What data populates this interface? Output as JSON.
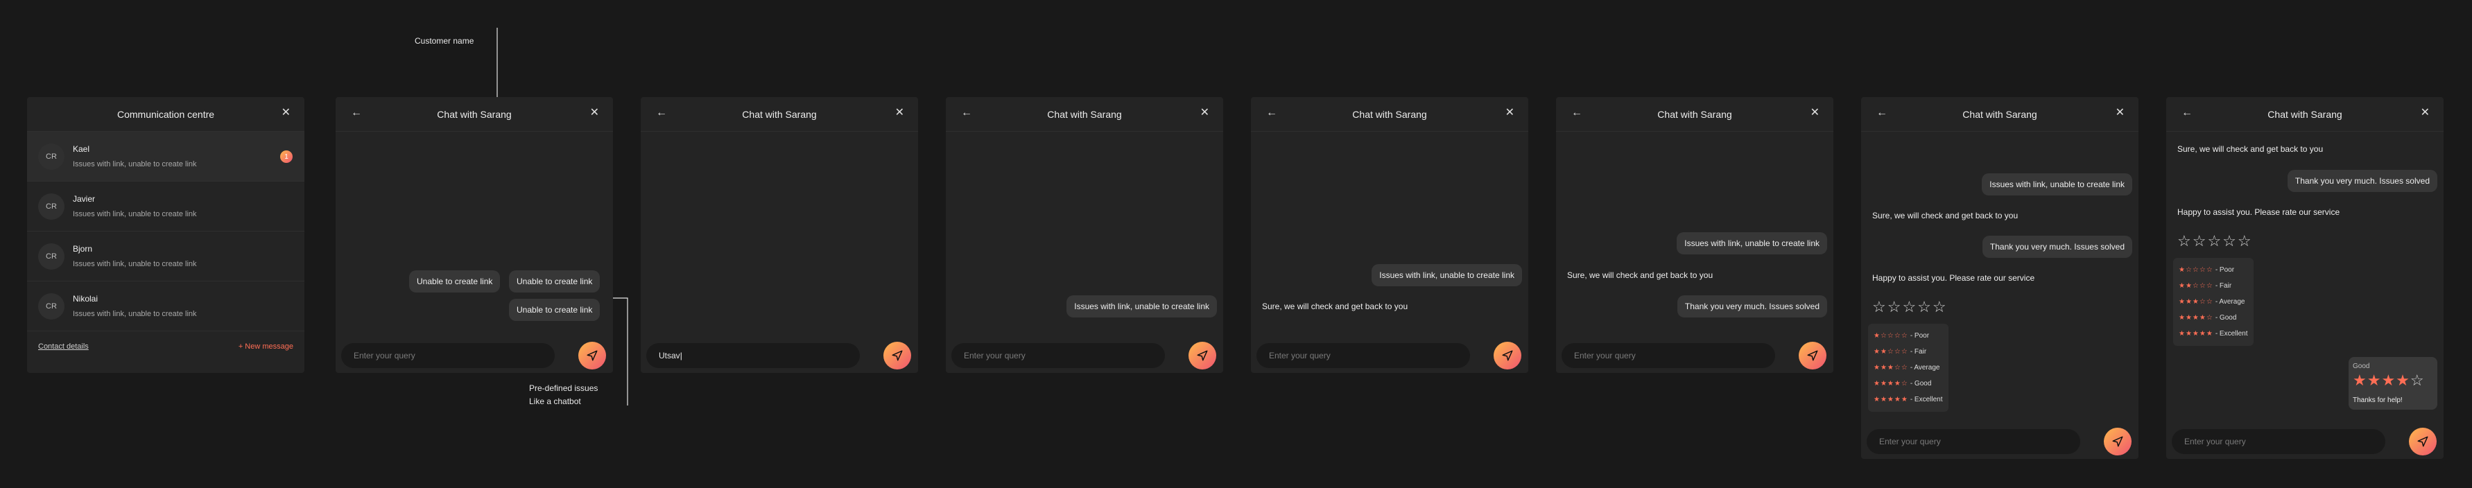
{
  "annotations": {
    "customer_name": "Customer name",
    "predefined_line1": "Pre-defined issues",
    "predefined_line2": "Like a chatbot"
  },
  "comm_centre": {
    "title": "Communication centre",
    "close": "✕",
    "contacts": [
      {
        "initials": "CR",
        "name": "Kael",
        "message": "Issues with link, unable to create link",
        "badge": "1"
      },
      {
        "initials": "CR",
        "name": "Javier",
        "message": "Issues with link, unable to create link"
      },
      {
        "initials": "CR",
        "name": "Bjorn",
        "message": "Issues with link, unable to create link"
      },
      {
        "initials": "CR",
        "name": "Nikolai",
        "message": "Issues with link, unable to create link"
      }
    ],
    "footer": {
      "contact_details": "Contact details",
      "new_message": "+ New message"
    }
  },
  "chat": {
    "title": "Chat with Sarang",
    "back": "←",
    "close": "✕",
    "placeholder": "Enter your query",
    "typed": "Utsav"
  },
  "messages": {
    "unable": "Unable to create link",
    "issues": "Issues with link, unable to create link",
    "reply": "Sure, we will check and get back to you",
    "thanks": "Thank you very much. Issues solved",
    "happy": "Happy to assist you. Please rate our service",
    "thanks_for_help": "Thanks for help!"
  },
  "rating": {
    "options": [
      {
        "stars": "★☆☆☆☆",
        "label": "- Poor",
        "value": 1
      },
      {
        "stars": "★★☆☆☆",
        "label": "- Fair",
        "value": 2
      },
      {
        "stars": "★★★☆☆",
        "label": "- Average",
        "value": 3
      },
      {
        "stars": "★★★★☆",
        "label": "- Good",
        "value": 4
      },
      {
        "stars": "★★★★★",
        "label": "- Excellent",
        "value": 5
      }
    ],
    "selected_label": "Good",
    "selected_value": 4
  },
  "colors": {
    "accent_start": "#ffb74d",
    "accent_end": "#f0566f",
    "star": "#ff6e55"
  }
}
